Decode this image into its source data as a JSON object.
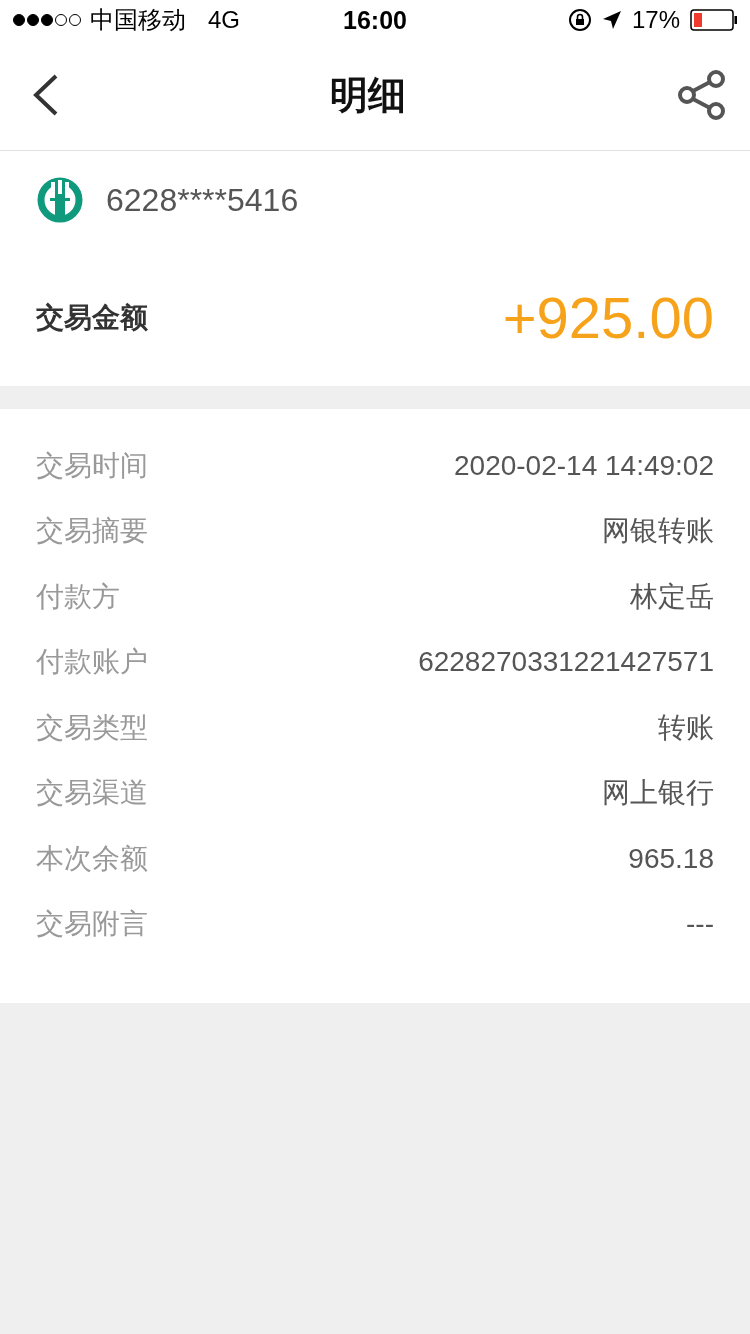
{
  "status_bar": {
    "carrier": "中国移动",
    "network": "4G",
    "time": "16:00",
    "battery": "17%"
  },
  "nav": {
    "title": "明细"
  },
  "account": {
    "card_number": "6228****5416"
  },
  "amount": {
    "label": "交易金额",
    "value": "+925.00"
  },
  "details": [
    {
      "label": "交易时间",
      "value": "2020-02-14 14:49:02"
    },
    {
      "label": "交易摘要",
      "value": "网银转账"
    },
    {
      "label": "付款方",
      "value": "林定岳"
    },
    {
      "label": "付款账户",
      "value": "6228270331221427571"
    },
    {
      "label": "交易类型",
      "value": "转账"
    },
    {
      "label": "交易渠道",
      "value": "网上银行"
    },
    {
      "label": "本次余额",
      "value": "965.18"
    },
    {
      "label": "交易附言",
      "value": "---"
    }
  ]
}
